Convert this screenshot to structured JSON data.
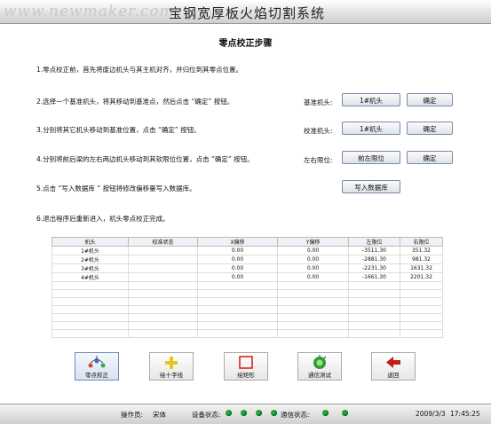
{
  "window": {
    "title": "宝钢宽厚板火焰切割系统",
    "watermark": "www.newmaker.com"
  },
  "heading": "零点校正步骤",
  "steps": [
    "1.零点校正前，首先将废边机头与其主机对齐，并归位到其零点位置。",
    "2.选择一个基准机头，将其移动到基准点，然后点击 “确定” 按钮。",
    "3.分别将其它机头移动到基准位置，点击 “确定” 按钮。",
    "4.分别将前后梁的左右两边机头移动到其软限位位置，点击 “确定” 按钮。",
    "5.点击 “写入数据库 ” 按钮将修改偏移量写入数据库。",
    "6.退出程序后重新进入，机头零点校正完成。"
  ],
  "controls": {
    "base_head": {
      "label": "基准机头:",
      "select": "1#机头",
      "ok": "确定"
    },
    "check_head": {
      "label": "校准机头:",
      "select": "1#机头",
      "ok": "确定"
    },
    "limit": {
      "label": "左右限位:",
      "select": "前左限位",
      "ok": "确定"
    },
    "write_db": "写入数据库"
  },
  "table": {
    "headers": [
      "机头",
      "校准状态",
      "X偏移",
      "Y偏移",
      "左限位",
      "右限位"
    ],
    "rows": [
      [
        "1#机头",
        "",
        "0.00",
        "0.00",
        "-3511.30",
        "351.32"
      ],
      [
        "2#机头",
        "",
        "0.00",
        "0.00",
        "-2881.30",
        "981.32"
      ],
      [
        "3#机头",
        "",
        "0.00",
        "0.00",
        "-2231.30",
        "1631.32"
      ],
      [
        "4#机头",
        "",
        "0.00",
        "0.00",
        "-1661.30",
        "2201.32"
      ]
    ],
    "empty_rows": 7
  },
  "toolbar": [
    {
      "label": "零点校正",
      "icon": "zero-calibration-icon"
    },
    {
      "label": "绘十字线",
      "icon": "crosshair-icon"
    },
    {
      "label": "绘矩形",
      "icon": "rectangle-icon"
    },
    {
      "label": "通信测试",
      "icon": "communication-test-icon"
    },
    {
      "label": "返回",
      "icon": "back-arrow-icon"
    }
  ],
  "status": {
    "operator_label": "操作员:",
    "operator": "宋体",
    "device_label": "设备状态:",
    "comm_label": "通信状态:",
    "date": "2009/3/3",
    "time": "17:45:25"
  },
  "colors": {
    "led_green": "#1fa83a",
    "title_gradient": "#cfcfcf"
  }
}
